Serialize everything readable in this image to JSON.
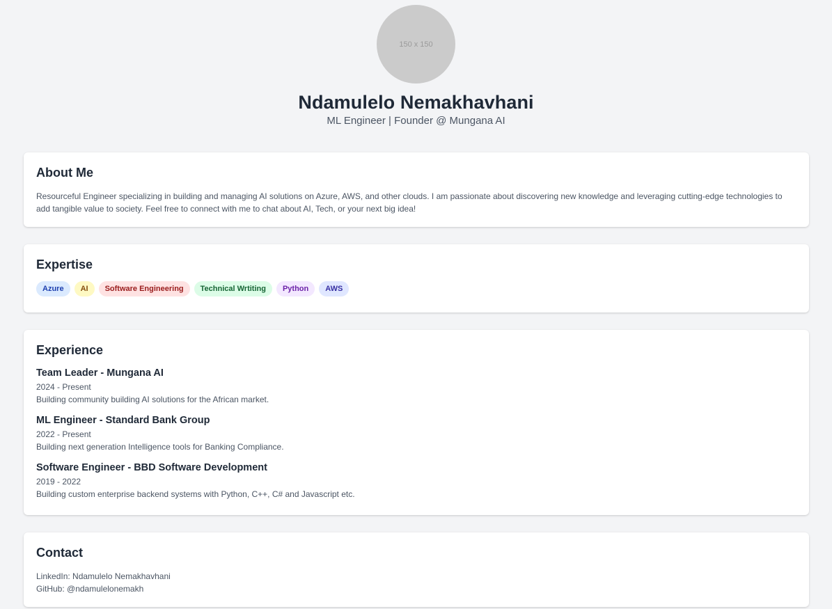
{
  "profile": {
    "avatar_placeholder": "150 x 150",
    "name": "Ndamulelo Nemakhavhani",
    "tagline": "ML Engineer | Founder @ Mungana AI"
  },
  "about": {
    "heading": "About Me",
    "text": "Resourceful Engineer specializing in building and managing AI solutions on Azure, AWS, and other clouds. I am passionate about discovering new knowledge and leveraging cutting-edge technologies to add tangible value to society. Feel free to connect with me to chat about AI, Tech, or your next big idea!"
  },
  "expertise": {
    "heading": "Expertise",
    "tags": [
      {
        "label": "Azure",
        "bg": "#dbeafe",
        "fg": "#1e40af"
      },
      {
        "label": "AI",
        "bg": "#fef9c3",
        "fg": "#854d0e"
      },
      {
        "label": "Software Engineering",
        "bg": "#fee2e2",
        "fg": "#991b1b"
      },
      {
        "label": "Technical Wrtiting",
        "bg": "#dcfce7",
        "fg": "#166534"
      },
      {
        "label": "Python",
        "bg": "#f3e8ff",
        "fg": "#6b21a8"
      },
      {
        "label": "AWS",
        "bg": "#e0e7ff",
        "fg": "#3730a3"
      }
    ]
  },
  "experience": {
    "heading": "Experience",
    "items": [
      {
        "title": "Team Leader - Mungana AI",
        "dates": "2024 - Present",
        "desc": "Building community building AI solutions for the African market."
      },
      {
        "title": "ML Engineer - Standard Bank Group",
        "dates": "2022 - Present",
        "desc": "Building next generation Intelligence tools for Banking Compliance."
      },
      {
        "title": "Software Engineer - BBD Software Development",
        "dates": "2019 - 2022",
        "desc": "Building custom enterprise backend systems with Python, C++, C# and Javascript etc."
      }
    ]
  },
  "contact": {
    "heading": "Contact",
    "linkedin_label": "LinkedIn:",
    "linkedin_value": "Ndamulelo Nemakhavhani",
    "github_label": "GitHub:",
    "github_value": "@ndamulelonemakh"
  }
}
